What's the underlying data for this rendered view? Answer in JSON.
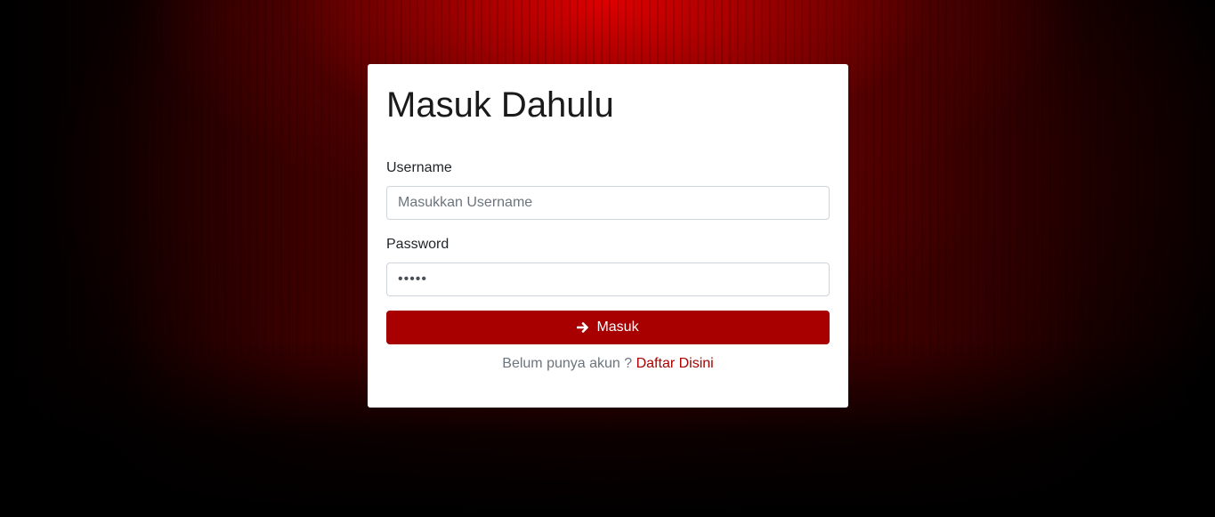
{
  "login": {
    "title": "Masuk Dahulu",
    "username_label": "Username",
    "username_placeholder": "Masukkan Username",
    "username_value": "",
    "password_label": "Password",
    "password_value": "•••••",
    "submit_label": "Masuk",
    "signup_prompt": "Belum punya akun ?",
    "signup_link": "Daftar Disini"
  },
  "theme": {
    "accent": "#a80000",
    "background": "#000000"
  },
  "icons": {
    "submit": "arrow-right-icon"
  }
}
